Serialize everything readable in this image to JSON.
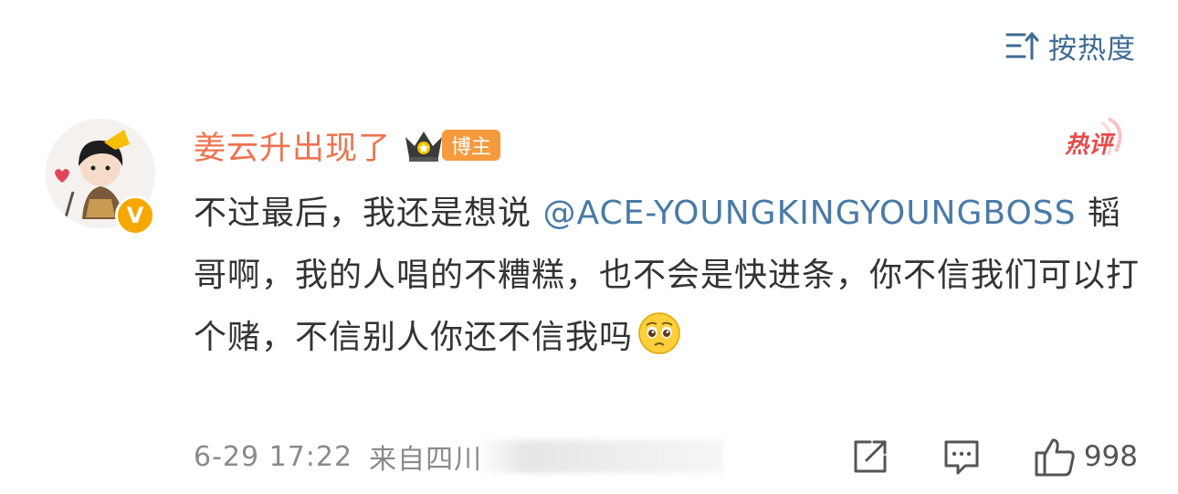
{
  "sort": {
    "label": "按热度",
    "icon": "sort-icon"
  },
  "comment": {
    "username": "姜云升出现了",
    "badge": "博主",
    "hot_tag": "热评",
    "content_before": "不过最后，我还是想说 ",
    "mention": "@ACE-YOUNGKINGYOUNGBOSS",
    "content_after": " 韬哥啊，我的人唱的不糟糕，也不会是快进条，你不信我们可以打个赌，不信别人你还不信我吗",
    "emoji": "pleading-face-icon",
    "date": "6-29 17:22",
    "location": "来自四川",
    "likes": "998"
  },
  "colors": {
    "username": "#eb7350",
    "mention": "#4a7aa6",
    "hot": "#e84a4a",
    "badge": "#f59a3d",
    "verified": "#f6a700"
  }
}
